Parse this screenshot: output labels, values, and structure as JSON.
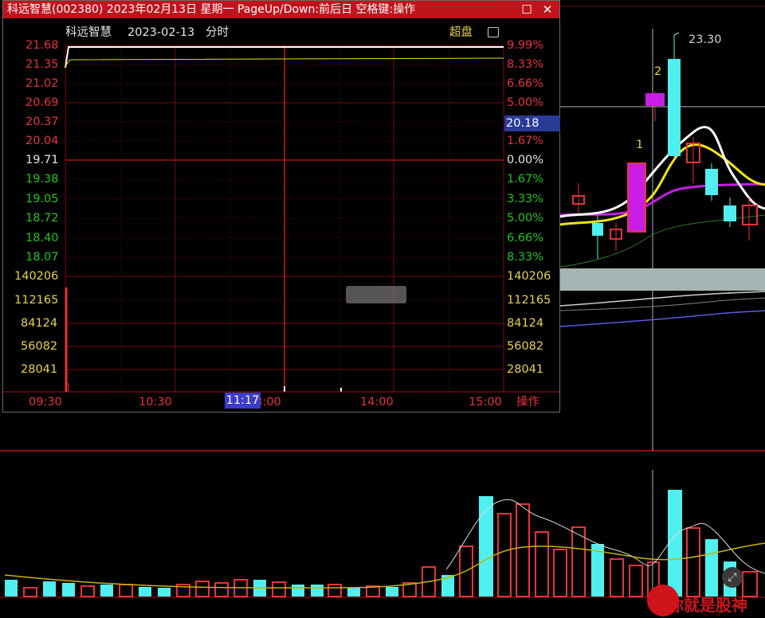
{
  "window": {
    "title": "科远智慧(002380) 2023年02月13日 星期一 PageUp/Down:前后日 空格键:操作",
    "restore_icon": "restore-icon",
    "close_icon": "close-icon"
  },
  "subheader": {
    "stock_name": "科远智慧",
    "date": "2023-02-13",
    "mode": "分时",
    "ultra_label": "超盘",
    "toggle_icon": "toggle-icon"
  },
  "price_axis_left": [
    {
      "value": "21.68",
      "color": "red"
    },
    {
      "value": "21.35",
      "color": "red"
    },
    {
      "value": "21.02",
      "color": "red"
    },
    {
      "value": "20.69",
      "color": "red"
    },
    {
      "value": "20.37",
      "color": "red"
    },
    {
      "value": "20.04",
      "color": "red"
    },
    {
      "value": "19.71",
      "color": "white"
    },
    {
      "value": "19.38",
      "color": "green"
    },
    {
      "value": "19.05",
      "color": "green"
    },
    {
      "value": "18.72",
      "color": "green"
    },
    {
      "value": "18.40",
      "color": "green"
    },
    {
      "value": "18.07",
      "color": "green"
    }
  ],
  "pct_axis_right": [
    {
      "value": "9.99%",
      "color": "red"
    },
    {
      "value": "8.33%",
      "color": "red"
    },
    {
      "value": "6.66%",
      "color": "red"
    },
    {
      "value": "5.00%",
      "color": "red"
    },
    {
      "value": "3.33%",
      "color": "red"
    },
    {
      "value": "1.67%",
      "color": "red"
    },
    {
      "value": "0.00%",
      "color": "white"
    },
    {
      "value": "1.67%",
      "color": "green"
    },
    {
      "value": "3.33%",
      "color": "green"
    },
    {
      "value": "5.00%",
      "color": "green"
    },
    {
      "value": "6.66%",
      "color": "green"
    },
    {
      "value": "8.33%",
      "color": "green"
    }
  ],
  "current_price_tag": "20.18",
  "volume_axis": [
    "140206",
    "112165",
    "84124",
    "56082",
    "28041"
  ],
  "time_axis": [
    "09:30",
    "10:30",
    "13:00",
    "14:00",
    "15:00"
  ],
  "time_cursor": "11:17",
  "operate_button": "操作",
  "kline": {
    "high_label": "23.30",
    "signal_1": "1",
    "signal_2": "2"
  },
  "watermark_text": "你就是股神",
  "colors": {
    "up_red": "#e8323c",
    "down_cyan": "#50f0f0",
    "magenta": "#c81ee6",
    "yellow_line": "#f0e614",
    "white_line": "#ffffff",
    "title_bar": "#c0141c"
  }
}
